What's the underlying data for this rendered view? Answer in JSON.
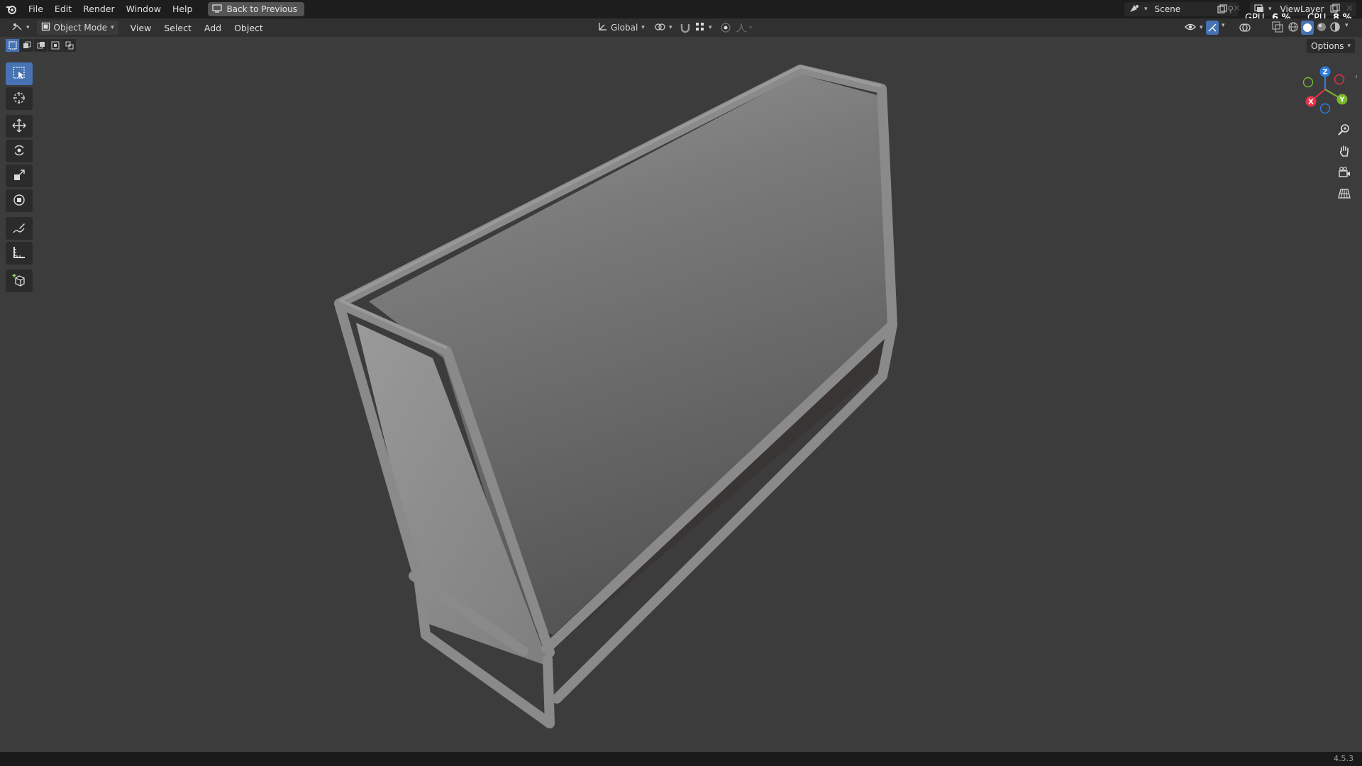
{
  "menu": {
    "items": [
      "File",
      "Edit",
      "Render",
      "Window",
      "Help"
    ],
    "back_button": "Back to Previous"
  },
  "scene": {
    "label": "Scene"
  },
  "view_layer": {
    "label": "ViewLayer"
  },
  "stats": {
    "gpu_label": "GPU",
    "gpu_value": "6 %",
    "cpu_label": "CPU",
    "cpu_value": "8 %"
  },
  "header": {
    "mode": "Object Mode",
    "menus": [
      "View",
      "Select",
      "Add",
      "Object"
    ],
    "orientation": "Global",
    "options": "Options"
  },
  "gizmo": {
    "z": "Z",
    "y": "Y",
    "x": "X"
  },
  "status": {
    "version": "4.5.3"
  },
  "colors": {
    "accent": "#4772b3",
    "x_axis": "#e6334a",
    "y_axis": "#7ab82a",
    "z_axis": "#2d7ce6"
  }
}
